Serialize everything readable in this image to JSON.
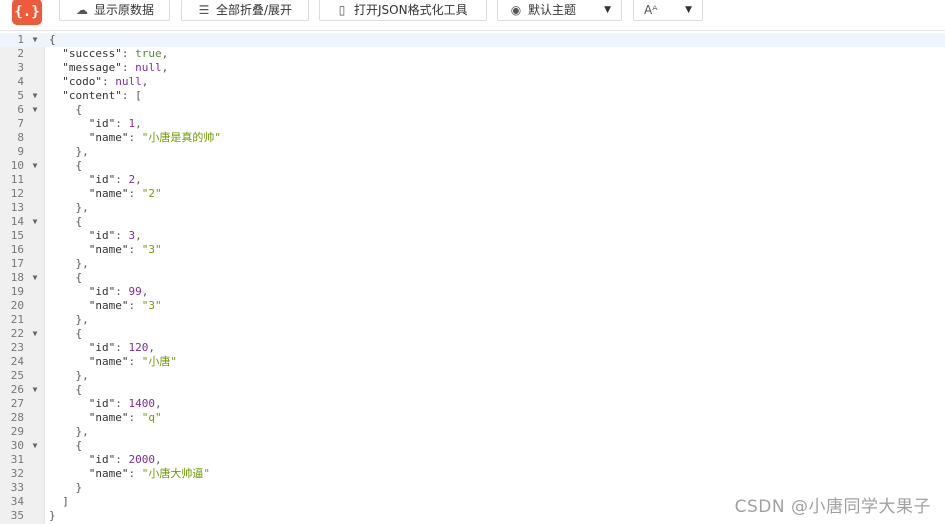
{
  "toolbar": {
    "logo_text": "{.}",
    "buttons": [
      {
        "label": "显示原数据",
        "icon": "cloud-icon"
      },
      {
        "label": "全部折叠/展开",
        "icon": "collapse-icon"
      },
      {
        "label": "打开JSON格式化工具",
        "icon": "json-file-icon"
      },
      {
        "label": "默认主题",
        "icon": "eye-icon"
      },
      {
        "label": "Aᴬ",
        "icon": "font-size-icon"
      }
    ]
  },
  "editor": {
    "lines": [
      {
        "n": "1",
        "fold": true,
        "tokens": [
          {
            "t": "{",
            "c": "p"
          }
        ]
      },
      {
        "n": "2",
        "tokens": [
          {
            "t": "  \"success\"",
            "c": "k"
          },
          {
            "t": ": ",
            "c": "p"
          },
          {
            "t": "true",
            "c": "b"
          },
          {
            "t": ",",
            "c": "p"
          }
        ]
      },
      {
        "n": "3",
        "tokens": [
          {
            "t": "  \"message\"",
            "c": "k"
          },
          {
            "t": ": ",
            "c": "p"
          },
          {
            "t": "null",
            "c": "n"
          },
          {
            "t": ",",
            "c": "p"
          }
        ]
      },
      {
        "n": "4",
        "tokens": [
          {
            "t": "  \"codo\"",
            "c": "k"
          },
          {
            "t": ": ",
            "c": "p"
          },
          {
            "t": "null",
            "c": "n"
          },
          {
            "t": ",",
            "c": "p"
          }
        ]
      },
      {
        "n": "5",
        "fold": true,
        "tokens": [
          {
            "t": "  \"content\"",
            "c": "k"
          },
          {
            "t": ": [",
            "c": "p"
          }
        ]
      },
      {
        "n": "6",
        "fold": true,
        "tokens": [
          {
            "t": "    {",
            "c": "p"
          }
        ]
      },
      {
        "n": "7",
        "tokens": [
          {
            "t": "      \"id\"",
            "c": "k"
          },
          {
            "t": ": ",
            "c": "p"
          },
          {
            "t": "1",
            "c": "nu"
          },
          {
            "t": ",",
            "c": "p"
          }
        ]
      },
      {
        "n": "8",
        "tokens": [
          {
            "t": "      \"name\"",
            "c": "k"
          },
          {
            "t": ": ",
            "c": "p"
          },
          {
            "t": "\"小唐是真的帅\"",
            "c": "s"
          }
        ]
      },
      {
        "n": "9",
        "tokens": [
          {
            "t": "    },",
            "c": "p"
          }
        ]
      },
      {
        "n": "10",
        "fold": true,
        "tokens": [
          {
            "t": "    {",
            "c": "p"
          }
        ]
      },
      {
        "n": "11",
        "tokens": [
          {
            "t": "      \"id\"",
            "c": "k"
          },
          {
            "t": ": ",
            "c": "p"
          },
          {
            "t": "2",
            "c": "nu"
          },
          {
            "t": ",",
            "c": "p"
          }
        ]
      },
      {
        "n": "12",
        "tokens": [
          {
            "t": "      \"name\"",
            "c": "k"
          },
          {
            "t": ": ",
            "c": "p"
          },
          {
            "t": "\"2\"",
            "c": "s"
          }
        ]
      },
      {
        "n": "13",
        "tokens": [
          {
            "t": "    },",
            "c": "p"
          }
        ]
      },
      {
        "n": "14",
        "fold": true,
        "tokens": [
          {
            "t": "    {",
            "c": "p"
          }
        ]
      },
      {
        "n": "15",
        "tokens": [
          {
            "t": "      \"id\"",
            "c": "k"
          },
          {
            "t": ": ",
            "c": "p"
          },
          {
            "t": "3",
            "c": "nu"
          },
          {
            "t": ",",
            "c": "p"
          }
        ]
      },
      {
        "n": "16",
        "tokens": [
          {
            "t": "      \"name\"",
            "c": "k"
          },
          {
            "t": ": ",
            "c": "p"
          },
          {
            "t": "\"3\"",
            "c": "s"
          }
        ]
      },
      {
        "n": "17",
        "tokens": [
          {
            "t": "    },",
            "c": "p"
          }
        ]
      },
      {
        "n": "18",
        "fold": true,
        "tokens": [
          {
            "t": "    {",
            "c": "p"
          }
        ]
      },
      {
        "n": "19",
        "tokens": [
          {
            "t": "      \"id\"",
            "c": "k"
          },
          {
            "t": ": ",
            "c": "p"
          },
          {
            "t": "99",
            "c": "nu"
          },
          {
            "t": ",",
            "c": "p"
          }
        ]
      },
      {
        "n": "20",
        "tokens": [
          {
            "t": "      \"name\"",
            "c": "k"
          },
          {
            "t": ": ",
            "c": "p"
          },
          {
            "t": "\"3\"",
            "c": "s"
          }
        ]
      },
      {
        "n": "21",
        "tokens": [
          {
            "t": "    },",
            "c": "p"
          }
        ]
      },
      {
        "n": "22",
        "fold": true,
        "tokens": [
          {
            "t": "    {",
            "c": "p"
          }
        ]
      },
      {
        "n": "23",
        "tokens": [
          {
            "t": "      \"id\"",
            "c": "k"
          },
          {
            "t": ": ",
            "c": "p"
          },
          {
            "t": "120",
            "c": "nu"
          },
          {
            "t": ",",
            "c": "p"
          }
        ]
      },
      {
        "n": "24",
        "tokens": [
          {
            "t": "      \"name\"",
            "c": "k"
          },
          {
            "t": ": ",
            "c": "p"
          },
          {
            "t": "\"小唐\"",
            "c": "s"
          }
        ]
      },
      {
        "n": "25",
        "tokens": [
          {
            "t": "    },",
            "c": "p"
          }
        ]
      },
      {
        "n": "26",
        "fold": true,
        "tokens": [
          {
            "t": "    {",
            "c": "p"
          }
        ]
      },
      {
        "n": "27",
        "tokens": [
          {
            "t": "      \"id\"",
            "c": "k"
          },
          {
            "t": ": ",
            "c": "p"
          },
          {
            "t": "1400",
            "c": "nu"
          },
          {
            "t": ",",
            "c": "p"
          }
        ]
      },
      {
        "n": "28",
        "tokens": [
          {
            "t": "      \"name\"",
            "c": "k"
          },
          {
            "t": ": ",
            "c": "p"
          },
          {
            "t": "\"q\"",
            "c": "s"
          }
        ]
      },
      {
        "n": "29",
        "tokens": [
          {
            "t": "    },",
            "c": "p"
          }
        ]
      },
      {
        "n": "30",
        "fold": true,
        "tokens": [
          {
            "t": "    {",
            "c": "p"
          }
        ]
      },
      {
        "n": "31",
        "tokens": [
          {
            "t": "      \"id\"",
            "c": "k"
          },
          {
            "t": ": ",
            "c": "p"
          },
          {
            "t": "2000",
            "c": "nu"
          },
          {
            "t": ",",
            "c": "p"
          }
        ]
      },
      {
        "n": "32",
        "tokens": [
          {
            "t": "      \"name\"",
            "c": "k"
          },
          {
            "t": ": ",
            "c": "p"
          },
          {
            "t": "\"小唐大帅逼\"",
            "c": "s"
          }
        ]
      },
      {
        "n": "33",
        "tokens": [
          {
            "t": "    }",
            "c": "p"
          }
        ]
      },
      {
        "n": "34",
        "tokens": [
          {
            "t": "  ]",
            "c": "p"
          }
        ]
      },
      {
        "n": "35",
        "tokens": [
          {
            "t": "}",
            "c": "p"
          }
        ]
      }
    ]
  },
  "watermark": "CSDN @小唐同学大果子"
}
